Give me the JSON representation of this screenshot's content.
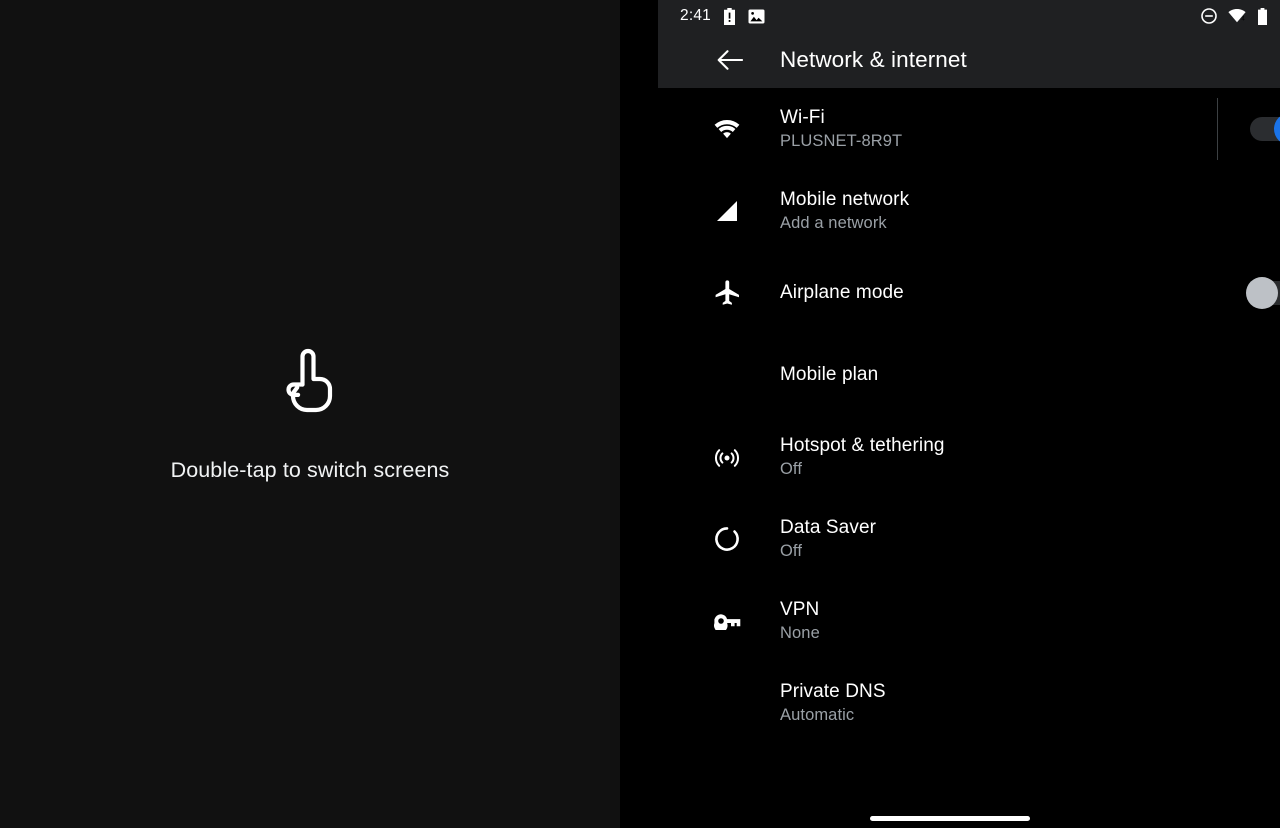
{
  "left_panel": {
    "hint_text": "Double-tap to switch screens",
    "icon": "pointing-hand-icon"
  },
  "phone": {
    "status_bar": {
      "clock": "2:41",
      "left_icons": [
        "battery-alert-icon",
        "image-icon"
      ],
      "right_icons": [
        "do-not-disturb-icon",
        "wifi-signal-icon",
        "battery-icon"
      ]
    },
    "app_bar": {
      "back_icon": "back-arrow-icon",
      "title": "Network & internet"
    },
    "nav": {
      "home_bar": "gesture-home-bar"
    },
    "rows": [
      {
        "icon": "wifi-icon",
        "title": "Wi-Fi",
        "subtitle": "PLUSNET-8R9T",
        "toggle": "on",
        "divider": true
      },
      {
        "icon": "signal-cellular-icon",
        "title": "Mobile network",
        "subtitle": "Add a network",
        "toggle": null,
        "divider": false
      },
      {
        "icon": "airplane-icon",
        "title": "Airplane mode",
        "subtitle": "",
        "toggle": "off",
        "divider": false
      },
      {
        "icon": "",
        "title": "Mobile plan",
        "subtitle": "",
        "toggle": null,
        "divider": false
      },
      {
        "icon": "hotspot-icon",
        "title": "Hotspot & tethering",
        "subtitle": "Off",
        "toggle": null,
        "divider": false
      },
      {
        "icon": "data-saver-icon",
        "title": "Data Saver",
        "subtitle": "Off",
        "toggle": null,
        "divider": false
      },
      {
        "icon": "vpn-key-icon",
        "title": "VPN",
        "subtitle": "None",
        "toggle": null,
        "divider": false
      },
      {
        "icon": "",
        "title": "Private DNS",
        "subtitle": "Automatic",
        "toggle": null,
        "divider": false
      }
    ]
  },
  "colors": {
    "background": "#000000",
    "left_panel_bg": "#111111",
    "app_bar_bg": "#1f2022",
    "title_text": "#ffffff",
    "subtitle_text": "#9aa0a6",
    "toggle_on_accent": "#1a73e8",
    "toggle_off_thumb": "#bdc1c6",
    "divider": "#3c4043"
  }
}
